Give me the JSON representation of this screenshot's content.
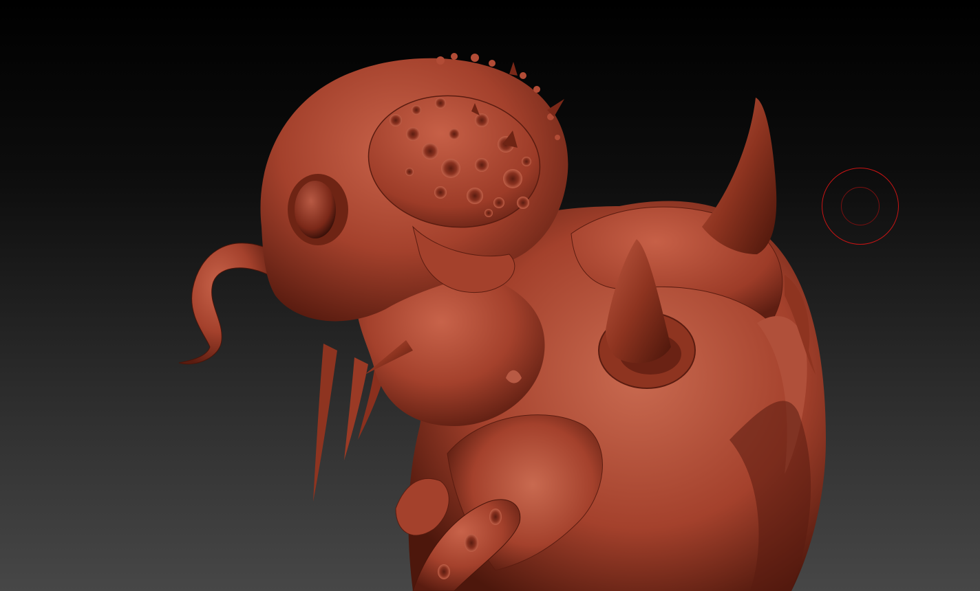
{
  "viewport": {
    "background_top": "#000000",
    "background_bottom": "#474747"
  },
  "model": {
    "material_base": "#a4412c",
    "material_light": "#c8634a",
    "material_dark": "#5a1c10",
    "material_shadow": "#3a0f08"
  },
  "brush": {
    "outer_color": "#c81414",
    "inner_color": "#7a1010"
  }
}
